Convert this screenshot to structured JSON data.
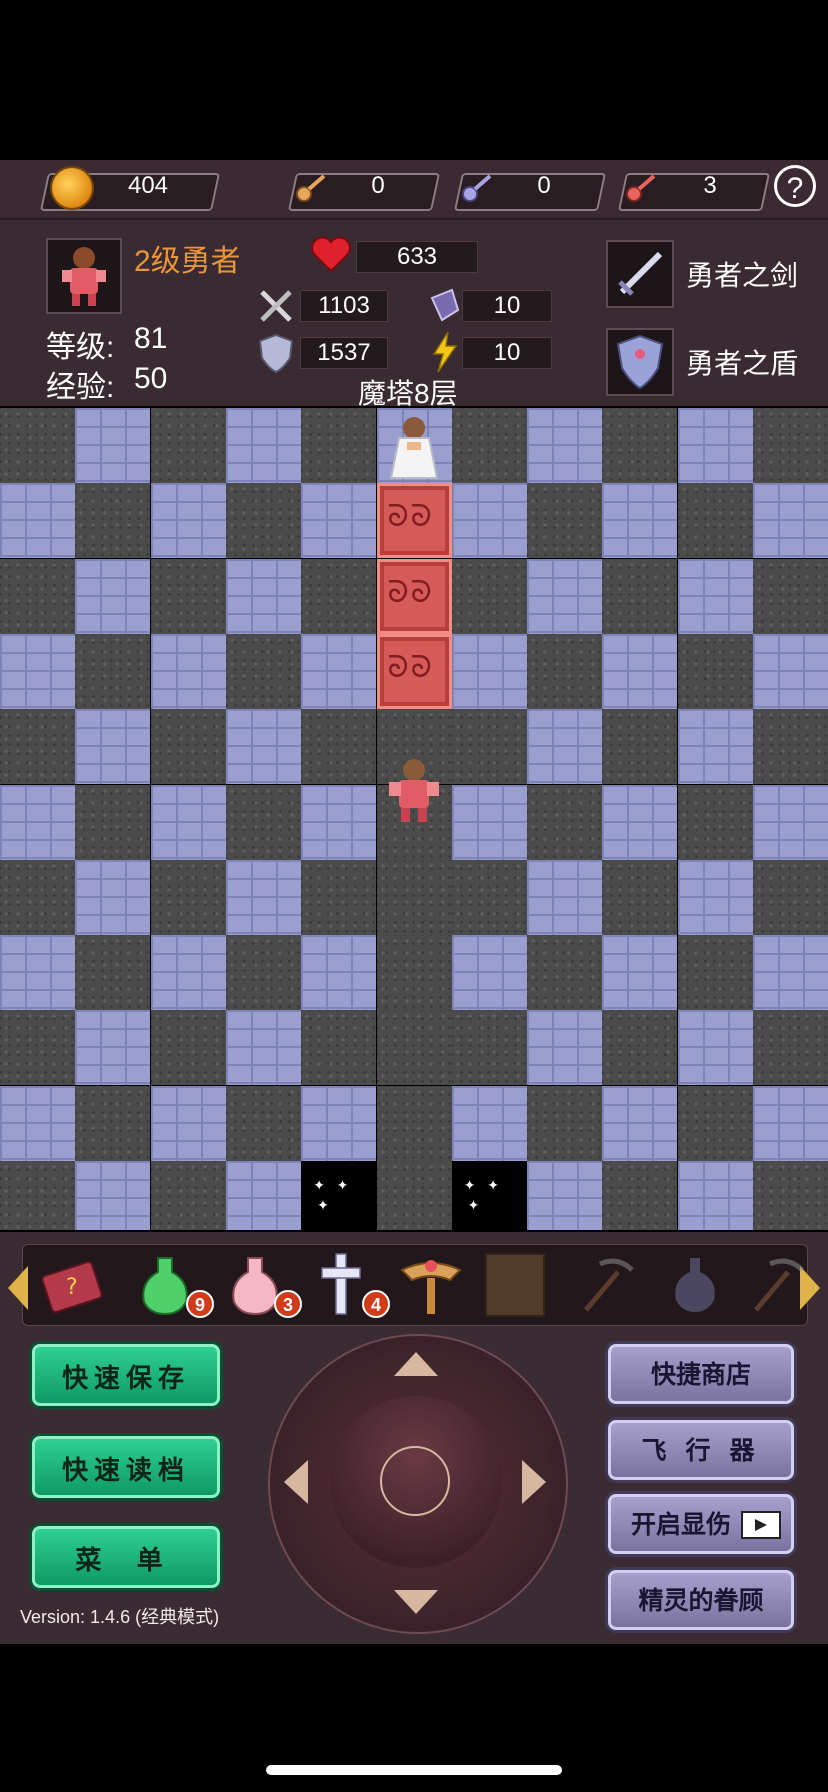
{
  "top_bar": {
    "coins": "404",
    "yellow_keys": "0",
    "blue_keys": "0",
    "red_keys": "3",
    "help_label": "?"
  },
  "hero": {
    "title": "2级勇者",
    "level_label": "等级:",
    "level": "81",
    "exp_label": "经验:",
    "exp": "50",
    "hp": "633",
    "attack": "1103",
    "defense": "1537",
    "magic_defense": "10",
    "agility": "10"
  },
  "equipment": {
    "weapon": "勇者之剑",
    "shield": "勇者之盾"
  },
  "floor_label": "魔塔8层",
  "items": {
    "green_potion_count": "9",
    "pink_potion_count": "3",
    "cross_count": "4"
  },
  "buttons": {
    "quick_save": "快速保存",
    "quick_load": "快速读档",
    "menu": "菜 单",
    "shop": "快捷商店",
    "fly": "飞 行 器",
    "damage": "开启显伤",
    "fairy": "精灵的眷顾"
  },
  "version": "Version: 1.4.6 (经典模式)",
  "colors": {
    "hero_title": "#e9953a",
    "accent_green": "#17b577",
    "accent_purple": "#8e86b6"
  }
}
